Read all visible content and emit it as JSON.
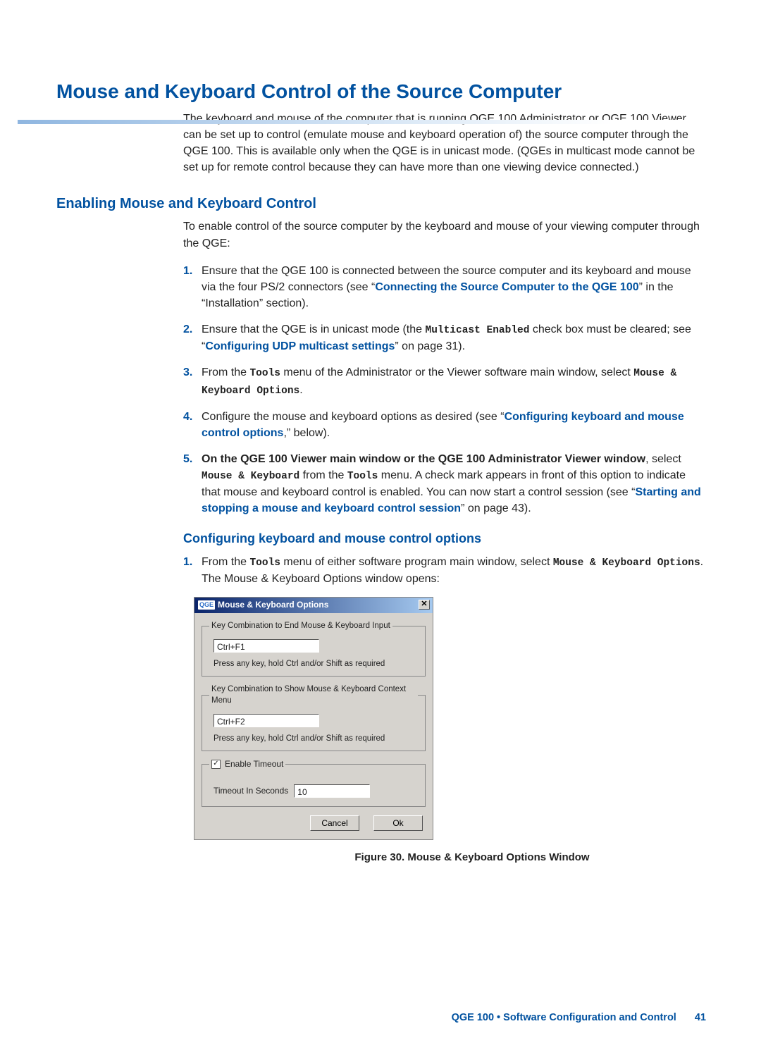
{
  "h1": "Mouse and Keyboard Control of the Source Computer",
  "intro": "The keyboard and mouse of the computer that is running QGE 100 Administrator or QGE 100 Viewer can be set up to control (emulate mouse and keyboard operation of) the source computer through the QGE 100. This is available only when the QGE is in unicast mode. (QGEs in multicast mode cannot be set up for remote control because they can have more than one viewing device connected.)",
  "h2": "Enabling Mouse and Keyboard Control",
  "lead": "To enable control of the source computer by the keyboard and mouse of your viewing computer through the QGE:",
  "steps": {
    "s1a": "Ensure that the QGE 100 is connected between the source computer and its keyboard and mouse via the four PS/2 connectors (see “",
    "s1link": "Connecting the Source Computer to the QGE 100",
    "s1b": "” in the “Installation” section).",
    "s2a": "Ensure that the QGE is in unicast mode (the ",
    "s2mono": "Multicast Enabled",
    "s2b": " check box must be cleared; see “",
    "s2link": "Configuring UDP multicast settings",
    "s2c": "” on page 31).",
    "s3a": "From the ",
    "s3mono1": "Tools",
    "s3b": " menu of the Administrator or the Viewer software main window, select ",
    "s3mono2": "Mouse & Keyboard Options",
    "s3c": ".",
    "s4a": "Configure the mouse and keyboard options as desired (see “",
    "s4link": "Configuring keyboard and mouse control options",
    "s4b": ",” below).",
    "s5bold": "On the QGE 100 Viewer main window or the QGE 100 Administrator Viewer window",
    "s5a": ", select ",
    "s5mono1": "Mouse & Keyboard",
    "s5b": " from the ",
    "s5mono2": "Tools",
    "s5c": " menu. A check mark appears in front of this option to indicate that mouse and keyboard control is enabled. You can now start a control session (see “",
    "s5link": "Starting and stopping a mouse and keyboard control session",
    "s5d": "” on page 43)."
  },
  "h3": "Configuring keyboard and mouse control options",
  "cfg": {
    "t1a": "From the ",
    "t1m1": "Tools",
    "t1b": " menu of either software program main window, select ",
    "t1m2": "Mouse & Keyboard Options",
    "t1c": ". The Mouse & Keyboard Options window opens:"
  },
  "dialog": {
    "qge": "QGE",
    "title": "Mouse & Keyboard Options",
    "close": "✕",
    "fs1": "Key Combination to End Mouse & Keyboard Input",
    "val1": "Ctrl+F1",
    "hint": "Press any key, hold Ctrl and/or Shift as required",
    "fs2": "Key Combination to Show Mouse & Keyboard Context Menu",
    "val2": "Ctrl+F2",
    "chk": "✓",
    "chk_label": "Enable Timeout",
    "to_label": "Timeout In Seconds",
    "to_val": "10",
    "cancel": "Cancel",
    "ok": "Ok"
  },
  "caption": "Figure 30.  Mouse & Keyboard Options Window",
  "footer": {
    "text": "QGE 100 • Software Configuration and Control",
    "page": "41"
  }
}
